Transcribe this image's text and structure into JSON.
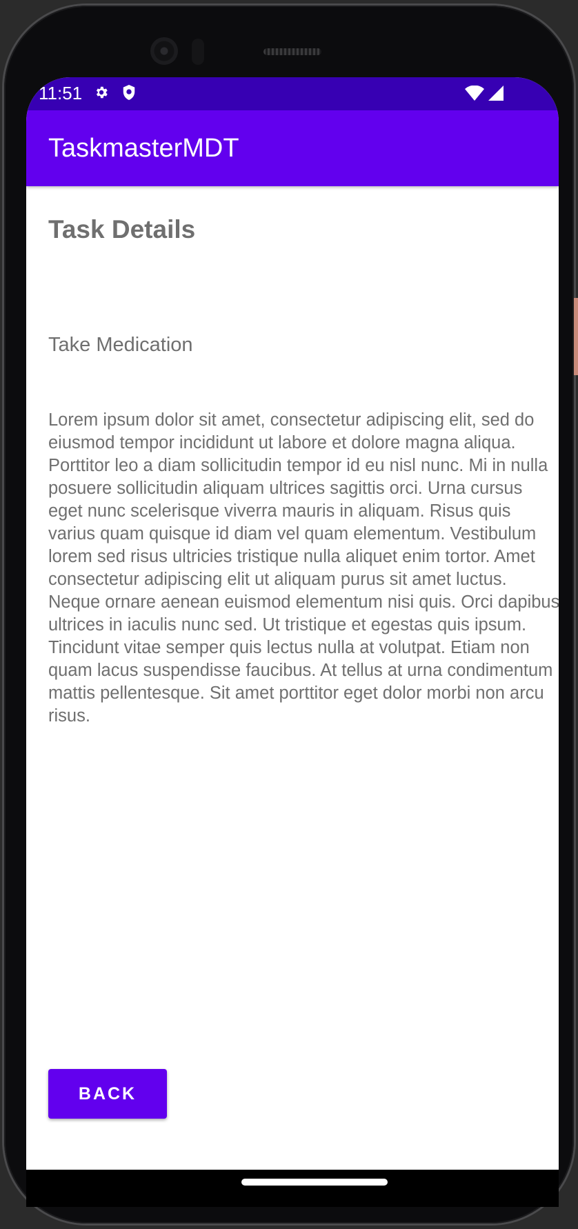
{
  "status_bar": {
    "time": "11:51",
    "icons_left": [
      "gear-icon",
      "shield-icon"
    ],
    "icons_right": [
      "wifi-icon",
      "signal-icon"
    ]
  },
  "app_bar": {
    "title": "TaskmasterMDT"
  },
  "details": {
    "heading": "Task Details",
    "task_title": "Take Medication",
    "task_body": "Lorem ipsum dolor sit amet, consectetur adipiscing elit, sed do eiusmod tempor incididunt ut labore et dolore magna aliqua. Porttitor leo a diam sollicitudin tempor id eu nisl nunc. Mi in nulla posuere sollicitudin aliquam ultrices sagittis orci. Urna cursus eget nunc scelerisque viverra mauris in aliquam. Risus quis varius quam quisque id diam vel quam elementum. Vestibulum lorem sed risus ultricies tristique nulla aliquet enim tortor. Amet consectetur adipiscing elit ut aliquam purus sit amet luctus. Neque ornare aenean euismod elementum nisi quis. Orci dapibus ultrices in iaculis nunc sed. Ut tristique et egestas quis ipsum. Tincidunt vitae semper quis lectus nulla at volutpat. Etiam non quam lacus suspendisse faucibus. At tellus at urna condimentum mattis pellentesque. Sit amet porttitor eget dolor morbi non arcu risus."
  },
  "actions": {
    "back_label": "BACK"
  },
  "colors": {
    "primary": "#6200ee",
    "primary_dark": "#3700b3",
    "text_secondary": "#6f6f6f"
  }
}
